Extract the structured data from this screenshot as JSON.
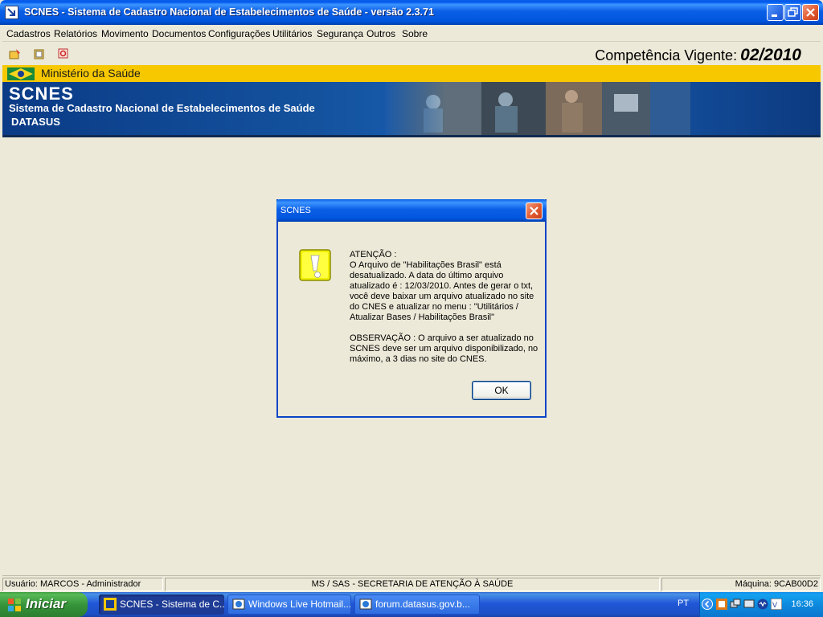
{
  "window": {
    "title": "SCNES - Sistema de Cadastro Nacional de Estabelecimentos de Saúde - versão 2.3.71"
  },
  "menu": [
    "Cadastros",
    "Relatórios",
    "Movimento",
    "Documentos",
    "Configurações",
    "Utilitários",
    "Segurança",
    "Outros",
    "Sobre"
  ],
  "toolbar": {
    "competencia_label": "Competência Vigente:",
    "competencia_value": "02/2010",
    "icons": [
      "wizard-icon",
      "open-icon",
      "exit-icon"
    ]
  },
  "banner": {
    "ministerio": "Ministério da Saúde",
    "title": "SCNES",
    "subtitle": "Sistema de Cadastro Nacional de Estabelecimentos de Saúde",
    "org": "DATASUS"
  },
  "dialog": {
    "title": "SCNES",
    "message": "ATENÇÃO :\nO Arquivo de \"Habilitações Brasil\" está desatualizado. A data do último arquivo atualizado é : 12/03/2010. Antes de gerar o txt, você deve baixar um arquivo atualizado no site do CNES e atualizar no menu : \"Utilitários / Atualizar Bases / Habilitações Brasil\"\n\nOBSERVAÇÃO : O arquivo a ser atualizado no SCNES deve ser um arquivo disponibilizado, no máximo, a 3 dias no site do CNES.",
    "ok_label": "OK",
    "icon": "warning-icon"
  },
  "status": {
    "user": "Usuário: MARCOS - Administrador",
    "org": "MS / SAS - SECRETARIA DE ATENÇÃO À SAÚDE",
    "host": "Máquina: 9CAB00D2"
  },
  "taskbar": {
    "start_label": "Iniciar",
    "tasks": [
      {
        "label": "SCNES - Sistema de C...",
        "active": true
      },
      {
        "label": "Windows Live Hotmail...",
        "active": false
      },
      {
        "label": "forum.datasus.gov.b...",
        "active": false
      }
    ],
    "language": "PT",
    "time": "16:36"
  },
  "colors": {
    "xp_blue": "#0a5fe6",
    "banner_yellow": "#f7c800",
    "banner_blue": "#14539f",
    "start_green": "#3f9e3f"
  }
}
